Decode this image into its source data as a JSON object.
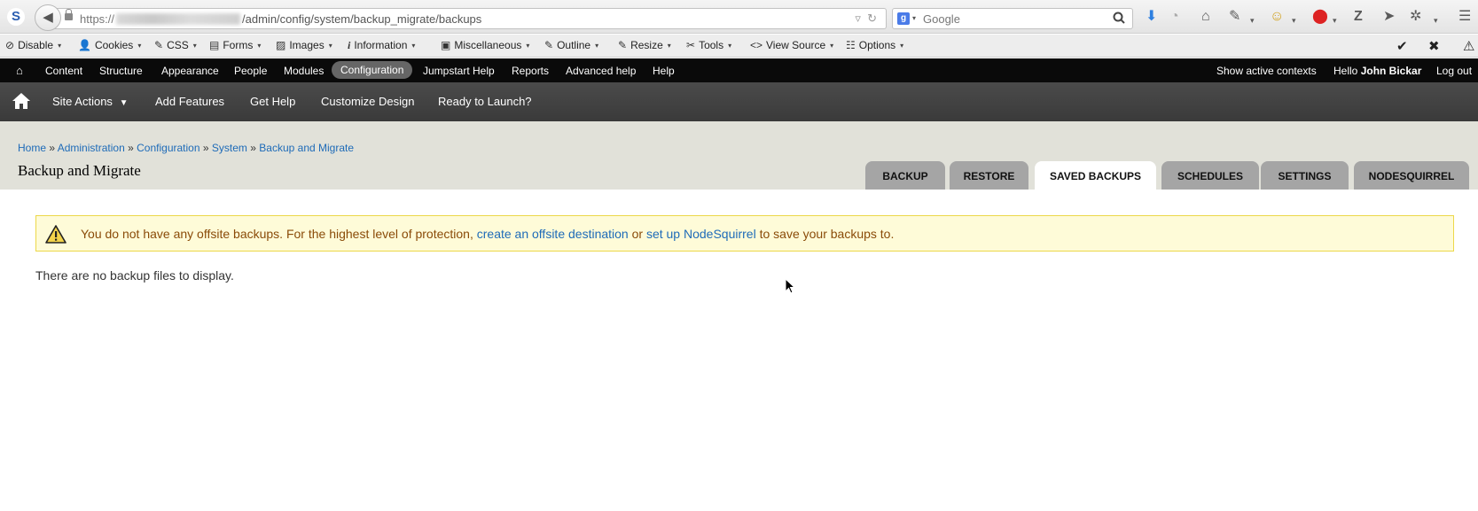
{
  "browser": {
    "site_identity": "S",
    "url": {
      "scheme": "https://",
      "path": "/admin/config/system/backup_migrate/backups"
    },
    "search": {
      "engine": "g",
      "placeholder": "Google"
    }
  },
  "devbar": {
    "items": [
      {
        "label": "Disable",
        "icon": "disable-icon"
      },
      {
        "label": "Cookies",
        "icon": "cookies-icon"
      },
      {
        "label": "CSS",
        "icon": "css-icon"
      },
      {
        "label": "Forms",
        "icon": "forms-icon"
      },
      {
        "label": "Images",
        "icon": "images-icon"
      },
      {
        "label": "Information",
        "icon": "information-icon"
      },
      {
        "label": "Miscellaneous",
        "icon": "miscellaneous-icon"
      },
      {
        "label": "Outline",
        "icon": "outline-icon"
      },
      {
        "label": "Resize",
        "icon": "resize-icon"
      },
      {
        "label": "Tools",
        "icon": "tools-icon"
      },
      {
        "label": "View Source",
        "icon": "view-source-icon"
      },
      {
        "label": "Options",
        "icon": "options-icon"
      }
    ]
  },
  "toolbar": {
    "items": [
      "Content",
      "Structure",
      "Appearance",
      "People",
      "Modules",
      "Configuration",
      "Jumpstart Help",
      "Reports",
      "Advanced help",
      "Help"
    ],
    "active": "Configuration",
    "show_contexts": "Show active contexts",
    "hello": "Hello ",
    "user": "John Bickar",
    "logout": "Log out"
  },
  "shortcuts": {
    "items": [
      "Site Actions",
      "Add Features",
      "Get Help",
      "Customize Design",
      "Ready to Launch?"
    ]
  },
  "header": {
    "breadcrumb": [
      "Home",
      "Administration",
      "Configuration",
      "System",
      "Backup and Migrate"
    ],
    "separator": "»",
    "title": "Backup and Migrate",
    "tabs": [
      "BACKUP",
      "RESTORE",
      "SAVED BACKUPS",
      "SCHEDULES",
      "SETTINGS",
      "NODESQUIRREL"
    ],
    "active_tab": "SAVED BACKUPS"
  },
  "warning": {
    "prefix": "You do not have any offsite backups. For the highest level of protection,",
    "link1": "create an offsite destination",
    "middle": "or",
    "link2": "set up NodeSquirrel",
    "suffix": "to save your backups to."
  },
  "content": {
    "empty_message": "There are no backup files to display."
  },
  "colors": {
    "toolbar_bg": "#0a0a0a",
    "shortcut_bg": "#444444",
    "header_bg": "#e1e1d9",
    "link": "#1e6bb8",
    "warning_bg": "#fefbd8",
    "warning_border": "#ecd84a",
    "warning_text": "#8a4b08"
  }
}
